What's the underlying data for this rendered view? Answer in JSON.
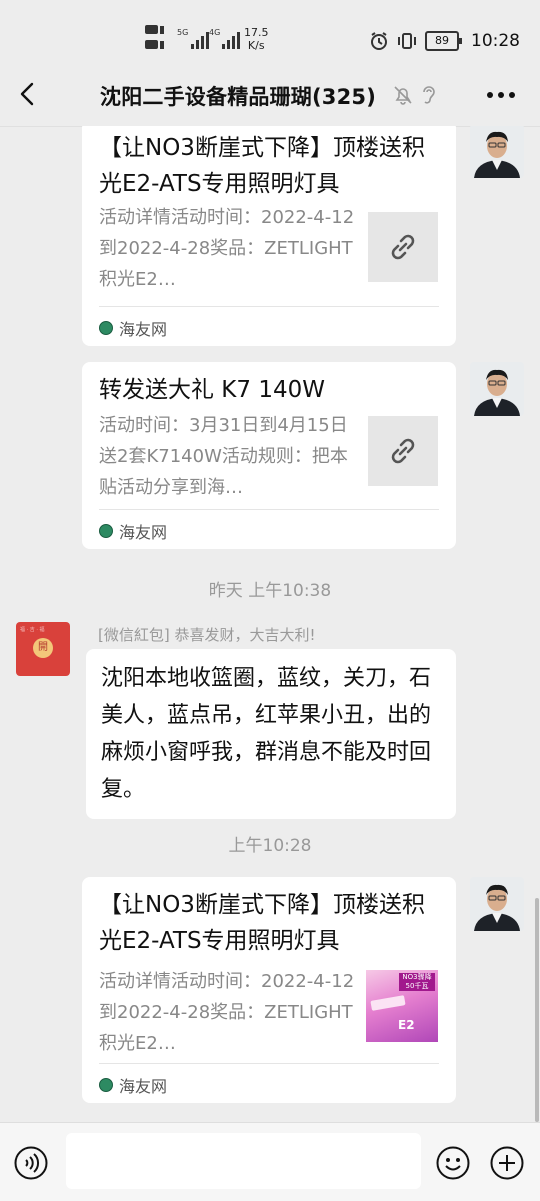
{
  "status_bar": {
    "speed_value": "17.5",
    "speed_unit": "K/s",
    "battery": "89",
    "time": "10:28"
  },
  "header": {
    "title": "沈阳二手设备精品珊瑚(325)"
  },
  "messages": [
    {
      "type": "link",
      "title": "【让NO3断崖式下降】顶楼送积光E2-ATS专用照明灯具",
      "desc": "活动详情活动时间：2022-4-12到2022-4-28奖品：ZETLIGHT积光E2…",
      "source": "海友网",
      "thumb": "link-icon"
    },
    {
      "type": "link",
      "title": "转发送大礼 K7 140W",
      "desc": "活动时间：3月31日到4月15日送2套K7140W活动规则：把本贴活动分享到海…",
      "source": "海友网",
      "thumb": "link-icon"
    },
    {
      "type": "time",
      "text": "昨天 上午10:38"
    },
    {
      "type": "red_packet",
      "notice": "[微信紅包]  恭喜发财，大吉大利!",
      "coin": "開"
    },
    {
      "type": "text",
      "text": "沈阳本地收篮圈，蓝纹，关刀，石美人，蓝点吊，红苹果小丑，出的麻烦小窗呼我，群消息不能及时回复。"
    },
    {
      "type": "time",
      "text": "上午10:28"
    },
    {
      "type": "link",
      "title": "【让NO3断崖式下降】顶楼送积光E2-ATS专用照明灯具",
      "desc": "活动详情活动时间：2022-4-12到2022-4-28奖品：ZETLIGHT积光E2…",
      "source": "海友网",
      "thumb": "product-image",
      "thumb_banner": "NO3骤降 50千瓦",
      "thumb_text": "E2"
    }
  ],
  "input": {
    "value": ""
  }
}
